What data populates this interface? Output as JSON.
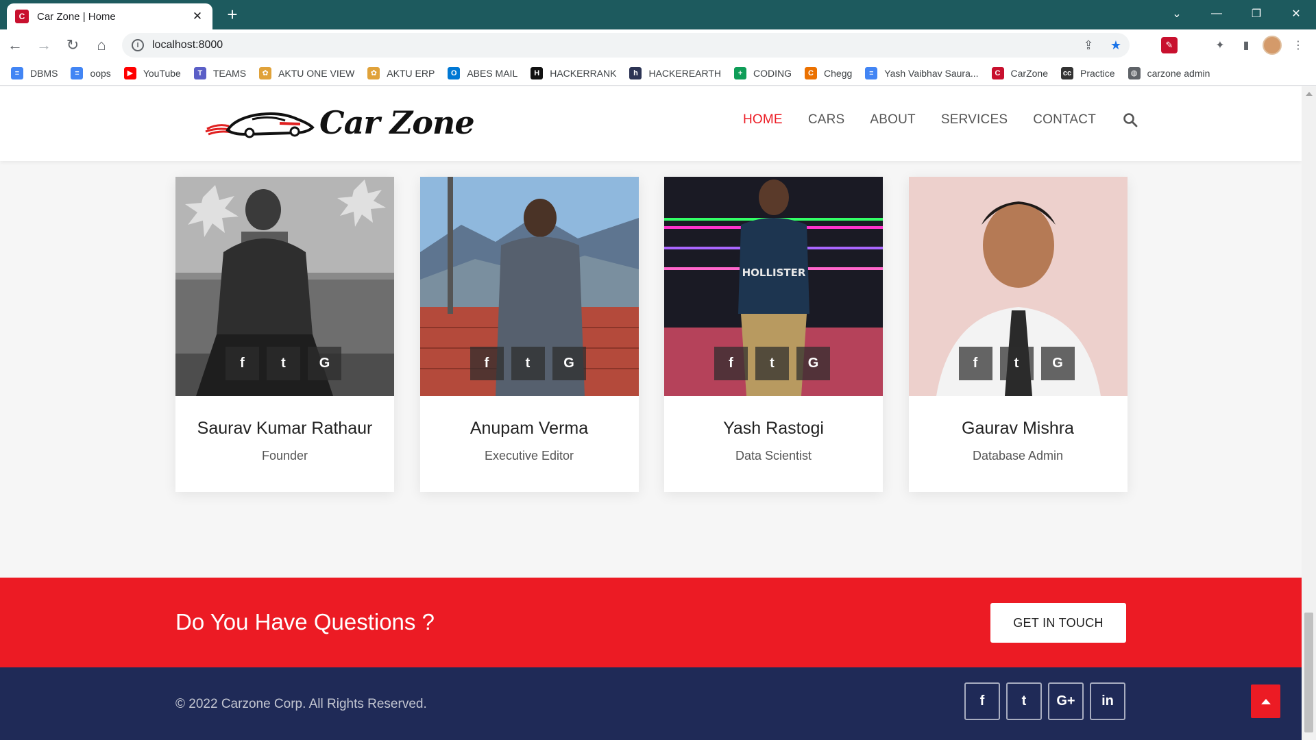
{
  "browser": {
    "tab_title": "Car Zone | Home",
    "tab_favicon": "carzone-favicon-icon",
    "url": "localhost:8000",
    "bookmarks": [
      {
        "label": "DBMS",
        "icon": "google-docs-icon",
        "color": "#4285f4",
        "glyph": "≡"
      },
      {
        "label": "oops",
        "icon": "google-docs-icon",
        "color": "#4285f4",
        "glyph": "≡"
      },
      {
        "label": "YouTube",
        "icon": "youtube-icon",
        "color": "#ff0000",
        "glyph": "▶"
      },
      {
        "label": "TEAMS",
        "icon": "teams-icon",
        "color": "#5b5fc7",
        "glyph": "T"
      },
      {
        "label": "AKTU ONE VIEW",
        "icon": "aktu-icon",
        "color": "#e0a23a",
        "glyph": "✿"
      },
      {
        "label": "AKTU ERP",
        "icon": "aktu-icon",
        "color": "#e0a23a",
        "glyph": "✿"
      },
      {
        "label": "ABES MAIL",
        "icon": "outlook-icon",
        "color": "#0078d4",
        "glyph": "O"
      },
      {
        "label": "HACKERRANK",
        "icon": "hackerrank-icon",
        "color": "#111111",
        "glyph": "H"
      },
      {
        "label": "HACKEREARTH",
        "icon": "hackerearth-icon",
        "color": "#2c3454",
        "glyph": "h"
      },
      {
        "label": "CODING",
        "icon": "google-sheets-icon",
        "color": "#0f9d58",
        "glyph": "+"
      },
      {
        "label": "Chegg",
        "icon": "chegg-icon",
        "color": "#eb7100",
        "glyph": "C"
      },
      {
        "label": "Yash Vaibhav Saura...",
        "icon": "google-docs-icon",
        "color": "#4285f4",
        "glyph": "≡"
      },
      {
        "label": "CarZone",
        "icon": "carzone-favicon-icon",
        "color": "#c8102e",
        "glyph": "C"
      },
      {
        "label": "Practice",
        "icon": "practice-icon",
        "color": "#333333",
        "glyph": "cc"
      },
      {
        "label": "carzone admin",
        "icon": "globe-icon",
        "color": "#5f6368",
        "glyph": "◍"
      }
    ]
  },
  "header": {
    "logo_text": "Car Zone",
    "nav": [
      {
        "label": "HOME",
        "active": true
      },
      {
        "label": "CARS",
        "active": false
      },
      {
        "label": "ABOUT",
        "active": false
      },
      {
        "label": "SERVICES",
        "active": false
      },
      {
        "label": "CONTACT",
        "active": false
      }
    ]
  },
  "team": [
    {
      "name": "Saurav Kumar Rathaur",
      "role": "Founder",
      "photo": "person-photo-bw"
    },
    {
      "name": "Anupam Verma",
      "role": "Executive Editor",
      "photo": "person-photo-mountains"
    },
    {
      "name": "Yash Rastogi",
      "role": "Data Scientist",
      "photo": "person-photo-night"
    },
    {
      "name": "Gaurav Mishra",
      "role": "Database Admin",
      "photo": "person-photo-portrait"
    }
  ],
  "card_social": [
    "f",
    "t",
    "G"
  ],
  "cta": {
    "title": "Do You Have Questions ?",
    "button": "GET IN TOUCH"
  },
  "footer": {
    "copyright": "© 2022 Carzone Corp. All Rights Reserved.",
    "social": [
      "f",
      "t",
      "G+",
      "in"
    ]
  },
  "colors": {
    "brand_red": "#ec1b24",
    "footer_navy": "#1f2a57",
    "tab_strip": "#1d5a5e"
  }
}
